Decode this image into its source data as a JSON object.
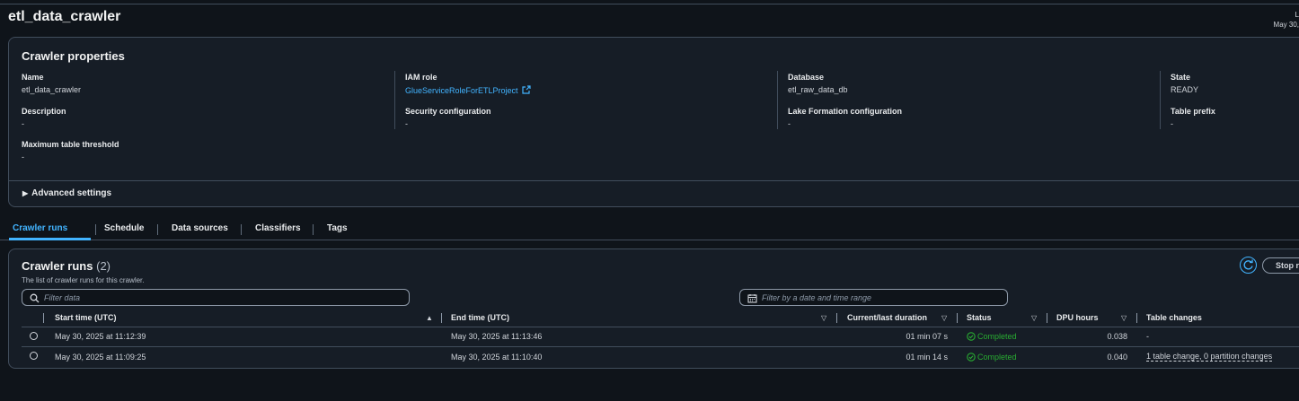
{
  "page": {
    "title": "etl_data_crawler",
    "corner_line1": "L",
    "corner_line2": "May 30,"
  },
  "properties": {
    "title": "Crawler properties",
    "name_label": "Name",
    "name_value": "etl_data_crawler",
    "iam_label": "IAM role",
    "iam_value": "GlueServiceRoleForETLProject",
    "database_label": "Database",
    "database_value": "etl_raw_data_db",
    "state_label": "State",
    "state_value": "READY",
    "description_label": "Description",
    "description_value": "-",
    "security_label": "Security configuration",
    "security_value": "-",
    "lakeformation_label": "Lake Formation configuration",
    "lakeformation_value": "-",
    "prefix_label": "Table prefix",
    "prefix_value": "-",
    "threshold_label": "Maximum table threshold",
    "threshold_value": "-",
    "advanced_label": "Advanced settings"
  },
  "tabs": [
    "Crawler runs",
    "Schedule",
    "Data sources",
    "Classifiers",
    "Tags"
  ],
  "runs": {
    "title": "Crawler runs",
    "count": "(2)",
    "subtitle": "The list of crawler runs for this crawler.",
    "filter_placeholder": "Filter data",
    "date_placeholder": "Filter by a date and time range",
    "stop_label": "Stop ru",
    "columns": {
      "start": "Start time (UTC)",
      "end": "End time (UTC)",
      "duration": "Current/last duration",
      "status": "Status",
      "dpu": "DPU hours",
      "changes": "Table changes"
    },
    "rows": [
      {
        "start": "May 30, 2025 at 11:12:39",
        "end": "May 30, 2025 at 11:13:46",
        "duration": "01 min 07 s",
        "status": "Completed",
        "dpu": "0.038",
        "changes": "-"
      },
      {
        "start": "May 30, 2025 at 11:09:25",
        "end": "May 30, 2025 at 11:10:40",
        "duration": "01 min 14 s",
        "status": "Completed",
        "dpu": "0.040",
        "changes": "1 table change, 0 partition changes"
      }
    ]
  },
  "colors": {
    "accent": "#42b4ff",
    "success": "#29ad32",
    "background": "#0f141a",
    "panel": "#161d26"
  }
}
